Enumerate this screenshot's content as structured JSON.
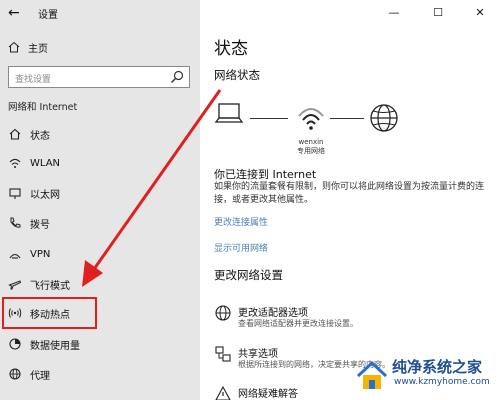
{
  "window": {
    "title": "设置",
    "minimize": "—",
    "maximize": "☐",
    "close": "✕"
  },
  "sidebar": {
    "home_label": "主页",
    "search_placeholder": "查找设置",
    "section_title": "网络和 Internet",
    "items": [
      {
        "label": "状态",
        "icon": "home-status-icon"
      },
      {
        "label": "WLAN",
        "icon": "wifi-icon"
      },
      {
        "label": "以太网",
        "icon": "ethernet-icon"
      },
      {
        "label": "拨号",
        "icon": "dialup-phone-icon"
      },
      {
        "label": "VPN",
        "icon": "vpn-icon"
      },
      {
        "label": "飞行模式",
        "icon": "airplane-icon"
      },
      {
        "label": "移动热点",
        "icon": "hotspot-icon"
      },
      {
        "label": "数据使用量",
        "icon": "data-usage-icon"
      },
      {
        "label": "代理",
        "icon": "globe-proxy-icon"
      }
    ],
    "highlight_color": "#e02020"
  },
  "main": {
    "title": "状态",
    "network_status_heading": "网络状态",
    "ssid": "wenxin",
    "ssid_sub": "专用网络",
    "connected_text": "你已连接到 Internet",
    "description": "如果你的流量套餐有限制，则你可以将此网络设置为按流量计费的连接，或者更改其他属性。",
    "links": {
      "change_properties": "更改连接属性",
      "show_networks": "显示可用网络"
    },
    "change_settings_heading": "更改网络设置",
    "options": [
      {
        "title": "更改适配器选项",
        "subtitle": "查看网络适配器并更改连接设置。"
      },
      {
        "title": "共享选项",
        "subtitle": "根据所连接到的网络，决定要共享的内容。"
      },
      {
        "title": "网络疑难解答",
        "subtitle": ""
      }
    ],
    "link_color": "#4a7fb5"
  },
  "watermark": {
    "text": "纯净系统之家",
    "url": "www.kzmyhome.com"
  },
  "annotation": {
    "arrow_color": "#e02020"
  }
}
